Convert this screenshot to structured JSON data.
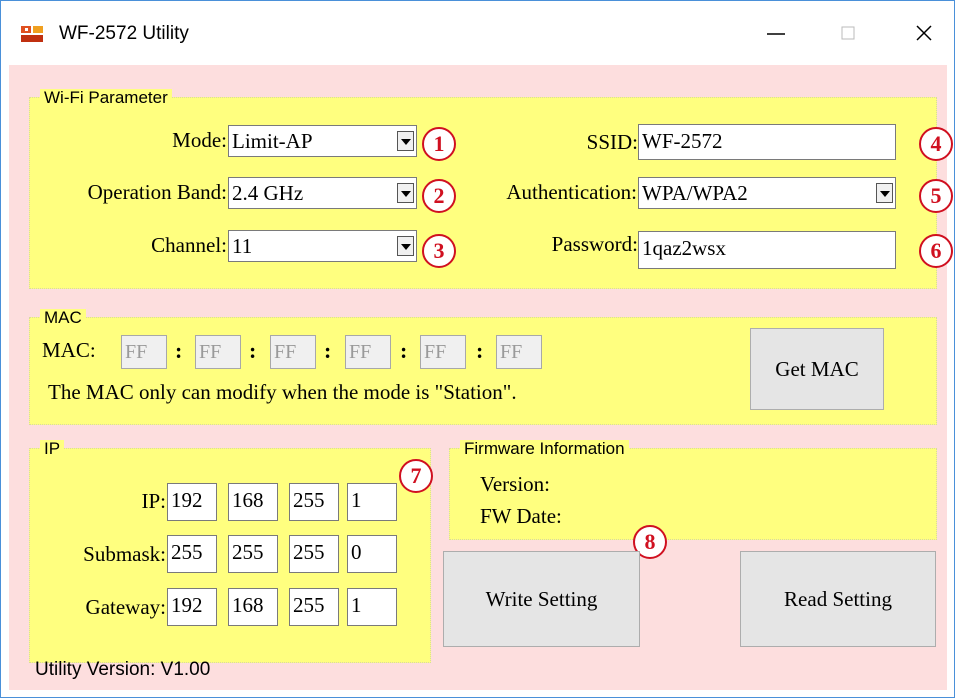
{
  "window": {
    "title": "WF-2572 Utility"
  },
  "wifi": {
    "legend": "Wi-Fi Parameter",
    "mode_label": "Mode:",
    "mode_value": "Limit-AP",
    "band_label": "Operation Band:",
    "band_value": "2.4 GHz",
    "channel_label": "Channel:",
    "channel_value": "11",
    "ssid_label": "SSID:",
    "ssid_value": "WF-2572",
    "auth_label": "Authentication:",
    "auth_value": "WPA/WPA2",
    "password_label": "Password:",
    "password_value": "1qaz2wsx"
  },
  "mac": {
    "legend": "MAC",
    "label": "MAC:",
    "octets": [
      "FF",
      "FF",
      "FF",
      "FF",
      "FF",
      "FF"
    ],
    "separator": ":",
    "note": "The MAC only can modify when the mode is \"Station\".",
    "get_button": "Get MAC"
  },
  "ip": {
    "legend": "IP",
    "ip_label": "IP:",
    "ip": [
      "192",
      "168",
      "255",
      "1"
    ],
    "submask_label": "Submask:",
    "submask": [
      "255",
      "255",
      "255",
      "0"
    ],
    "gateway_label": "Gateway:",
    "gateway": [
      "192",
      "168",
      "255",
      "1"
    ]
  },
  "firmware": {
    "legend": "Firmware Information",
    "version_label": "Version:",
    "date_label": "FW Date:"
  },
  "buttons": {
    "write": "Write Setting",
    "read": "Read Setting"
  },
  "footer": {
    "version": "Utility Version: V1.00"
  },
  "badges": [
    "1",
    "2",
    "3",
    "4",
    "5",
    "6",
    "7",
    "8"
  ],
  "colors": {
    "background": "#fddede",
    "group": "#ffff7f",
    "badge": "#d01020"
  }
}
